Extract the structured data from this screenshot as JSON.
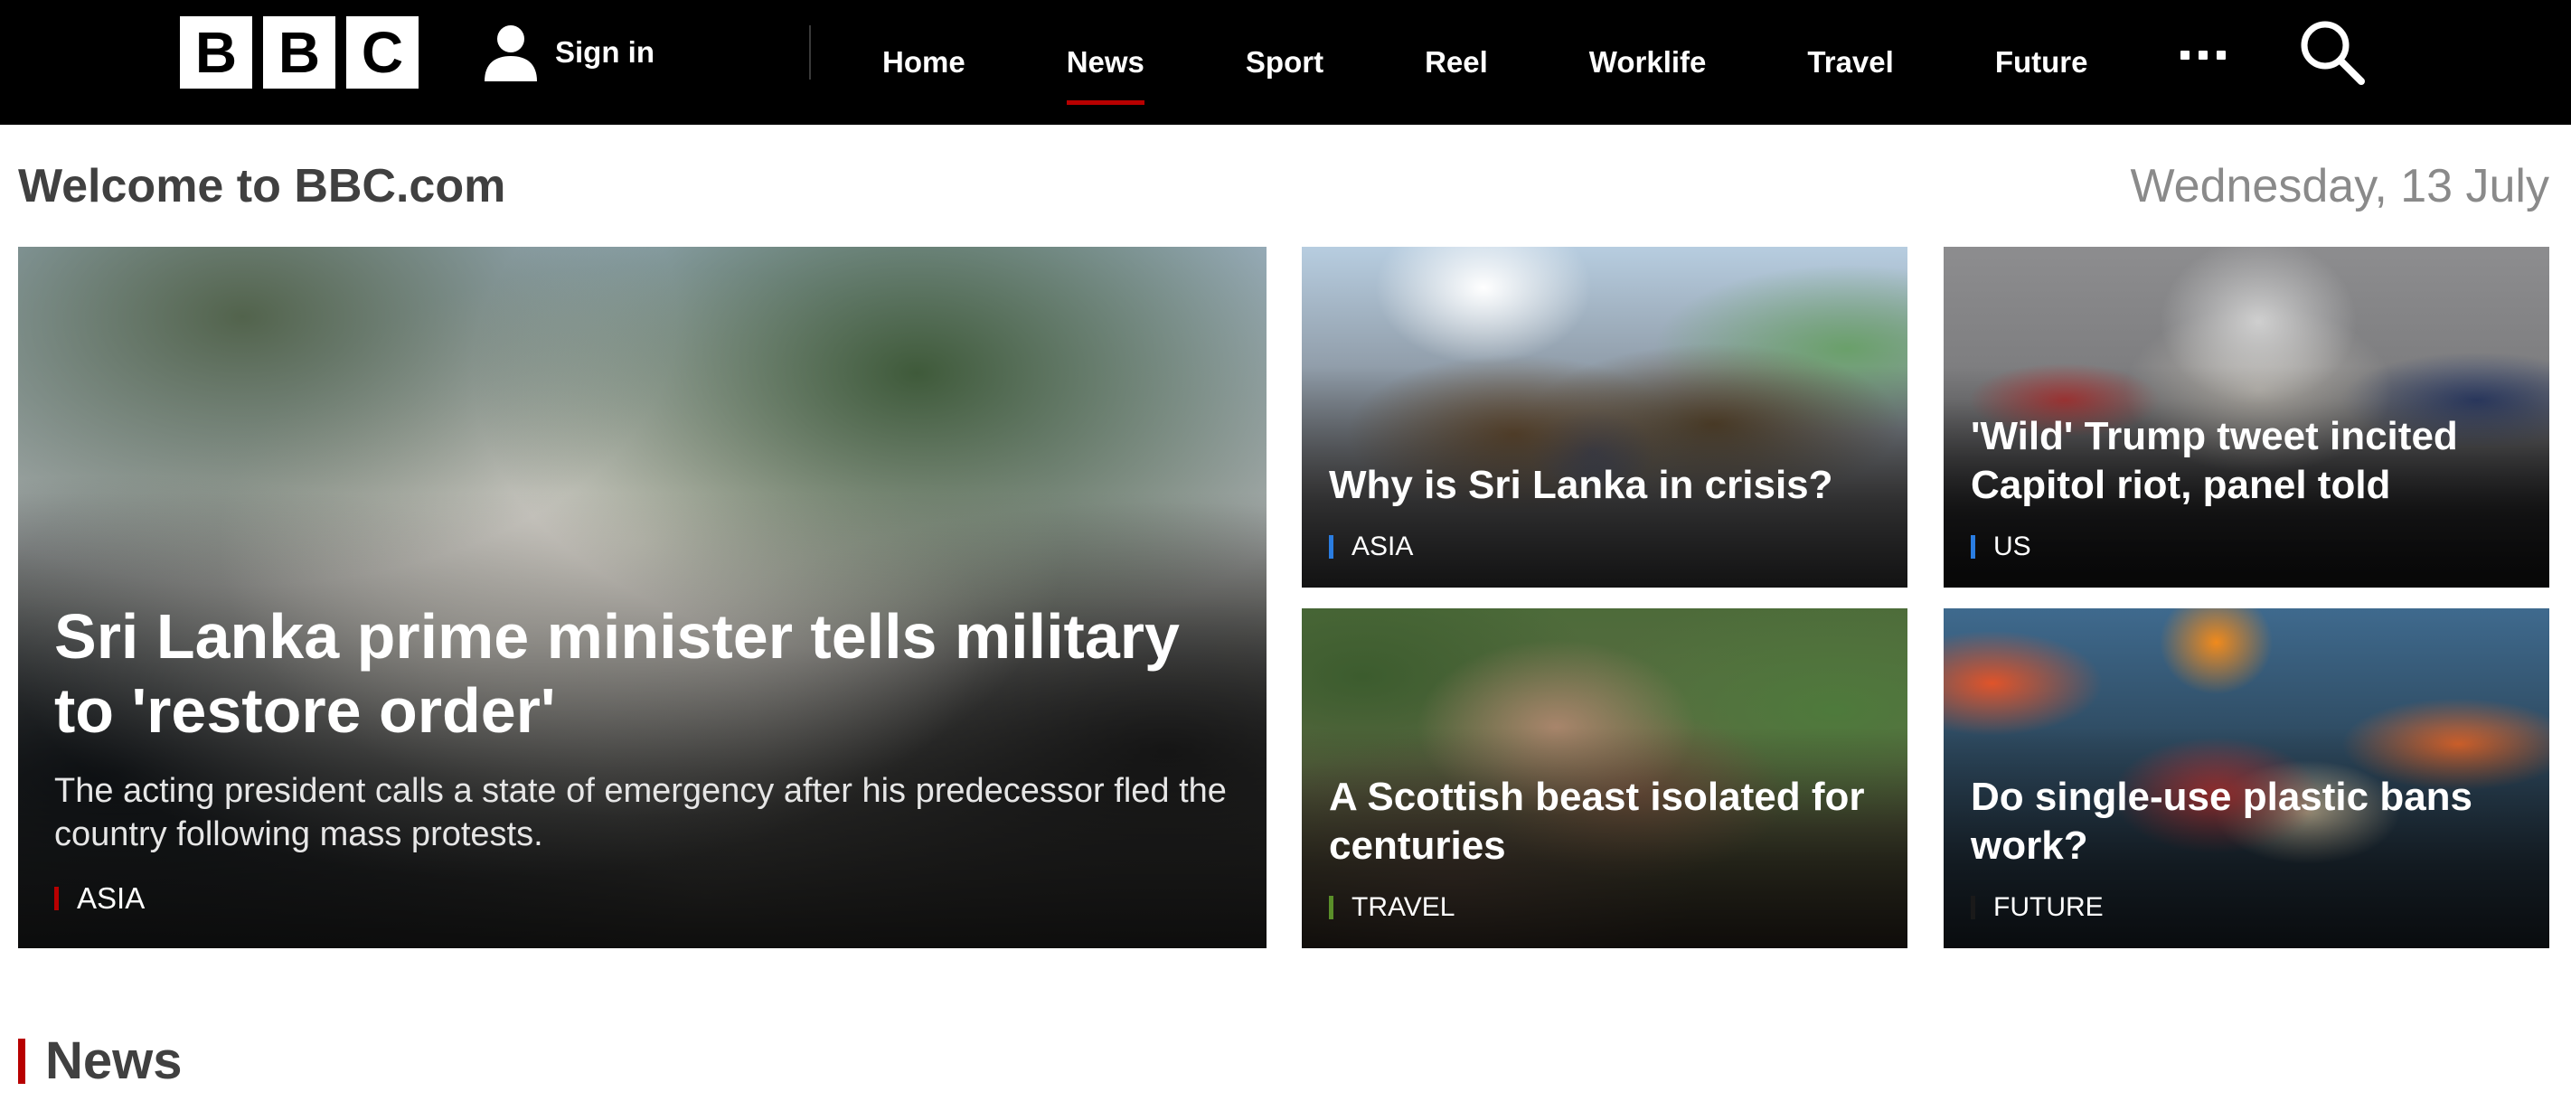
{
  "header": {
    "logo": [
      "B",
      "B",
      "C"
    ],
    "signin_label": "Sign in",
    "nav": [
      {
        "label": "Home",
        "active": false
      },
      {
        "label": "News",
        "active": true
      },
      {
        "label": "Sport",
        "active": false
      },
      {
        "label": "Reel",
        "active": false
      },
      {
        "label": "Worklife",
        "active": false
      },
      {
        "label": "Travel",
        "active": false
      },
      {
        "label": "Future",
        "active": false
      }
    ],
    "more_icon": "more-icon",
    "search_icon": "search-icon"
  },
  "welcome": {
    "title": "Welcome to BBC.com",
    "date": "Wednesday, 13 July"
  },
  "stories": {
    "hero": {
      "title": "Sri Lanka prime minister tells military to 'restore order'",
      "summary": "The acting president calls a state of emergency after his predecessor fled the country following mass protests.",
      "tag": "ASIA",
      "tag_color": "#b80000"
    },
    "s1": {
      "title": "Why is Sri Lanka in crisis?",
      "tag": "ASIA",
      "tag_color": "#2a7de1"
    },
    "s2": {
      "title": "'Wild' Trump tweet incited Capitol riot, panel told",
      "tag": "US",
      "tag_color": "#2a7de1"
    },
    "s3": {
      "title": "A Scottish beast isolated for centuries",
      "tag": "TRAVEL",
      "tag_color": "#5a8f29"
    },
    "s4": {
      "title": "Do single-use plastic bans work?",
      "tag": "FUTURE",
      "tag_color": "#1a1a1a"
    }
  },
  "section": {
    "title": "News",
    "accent": "#b80000"
  }
}
